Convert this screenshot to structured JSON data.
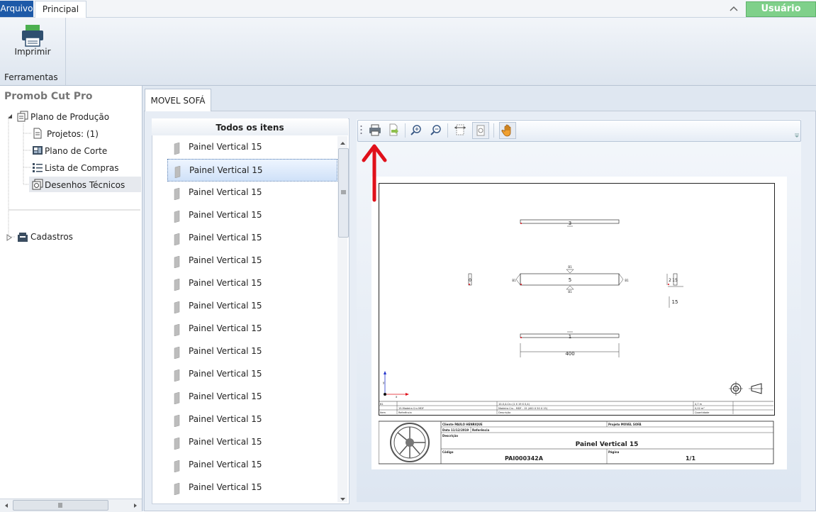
{
  "ribbon_tabs": {
    "file": "Arquivo",
    "home": "Principal"
  },
  "user_button": "Usuário",
  "ribbon": {
    "print_label": "Imprimir",
    "group_label": "Ferramentas"
  },
  "left_panel": {
    "title": "Promob Cut Pro",
    "tree": {
      "production_plan": "Plano de Produção",
      "projects": "Projetos: (1)",
      "cut_plan": "Plano de Corte",
      "purchase_list": "Lista de Compras",
      "technical_drawings": "Desenhos Técnicos",
      "registrations": "Cadastros"
    }
  },
  "document_tab": "MOVEL SOFÁ",
  "item_list": {
    "header": "Todos os itens",
    "items": [
      "Painel Vertical 15",
      "Painel Vertical 15",
      "Painel Vertical 15",
      "Painel Vertical 15",
      "Painel Vertical 15",
      "Painel Vertical 15",
      "Painel Vertical 15",
      "Painel Vertical 15",
      "Painel Vertical 15",
      "Painel Vertical 15",
      "Painel Vertical 15",
      "Painel Vertical 15",
      "Painel Vertical 15",
      "Painel Vertical 15",
      "Painel Vertical 15",
      "Painel Vertical 15"
    ],
    "selected_index": 1
  },
  "drawing": {
    "dim_top": "3",
    "dim_center": "5",
    "dim_left": "0",
    "dim_right_a": "2",
    "dim_right_b": "15",
    "dim_right_c": "15",
    "dim_bottom": "1",
    "dim_length": "400",
    "edge_marks": [
      "B1",
      "B1",
      "B1",
      "B1"
    ],
    "axis": {
      "y": "y",
      "x": "x"
    },
    "info_rows": [
      [
        "B1",
        "",
        "10-0,4-Cru (1 X 19 X 0,4)",
        "4,7 m"
      ],
      [
        "",
        "15-Madeira Cru MDF",
        "Madeira Cru - MDF - 15 (400 X 50 X 15)",
        "0,02 m²"
      ],
      [
        "Item",
        "Referência",
        "Descrição",
        "Quantidade"
      ]
    ],
    "title_block": {
      "client": "Cliente PAULO HENRIQUE",
      "project": "Projeto MOVEL SOFÁ",
      "date": "Data 11/12/2019",
      "reference": "Referência",
      "description_label": "Descrição",
      "description": "Painel Vertical 15",
      "code_label": "Código",
      "code": "PAI000342A",
      "page_label": "Página",
      "page": "1/1"
    }
  },
  "annotation_color": "#e0101a"
}
